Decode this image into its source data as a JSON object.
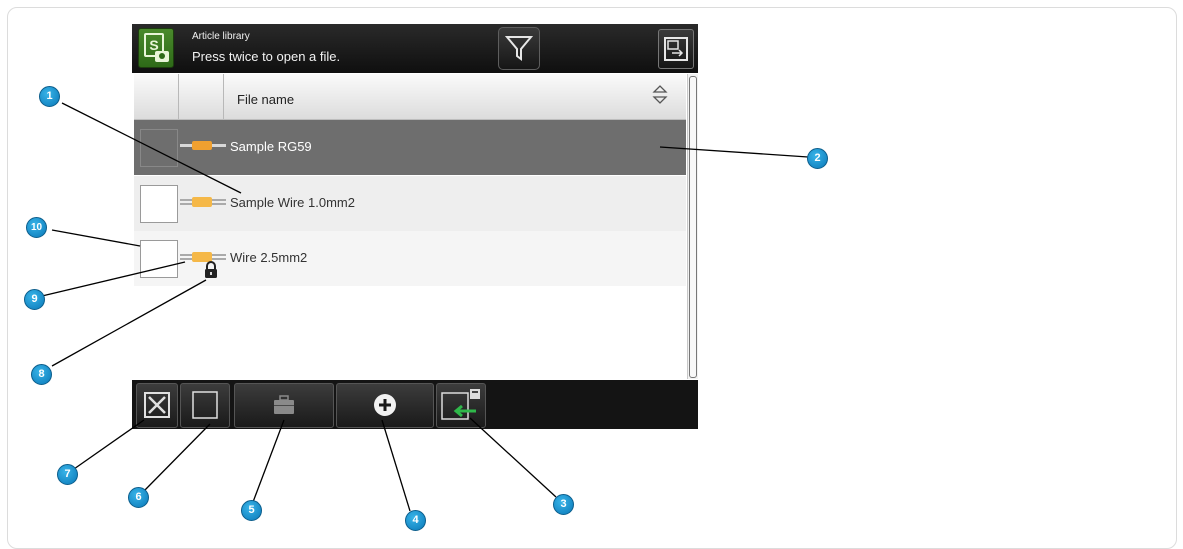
{
  "titlebar": {
    "app_icon": "article-library-app-icon",
    "small_title": "Article library",
    "hint": "Press twice to open a file.",
    "filter_icon": "funnel-icon",
    "switch_icon": "switch-view-icon"
  },
  "table": {
    "column_header": "File name",
    "sort_icon": "sort-updown-icon",
    "rows": [
      {
        "name": "Sample RG59",
        "selected": true,
        "locked": false
      },
      {
        "name": "Sample Wire 1.0mm2",
        "selected": false,
        "locked": false
      },
      {
        "name": "Wire 2.5mm2",
        "selected": false,
        "locked": true
      }
    ]
  },
  "toolbar": {
    "buttons": [
      "deselect-all-icon",
      "select-icon",
      "briefcase-icon",
      "add-circle-icon",
      "import-file-icon"
    ]
  },
  "callouts": [
    "1",
    "2",
    "3",
    "4",
    "5",
    "6",
    "7",
    "8",
    "9",
    "10"
  ],
  "colors": {
    "titlebar": "#141414",
    "selected_row": "#6e6e6e",
    "callout": "#1a8fd0",
    "wire": "#f0a030"
  }
}
